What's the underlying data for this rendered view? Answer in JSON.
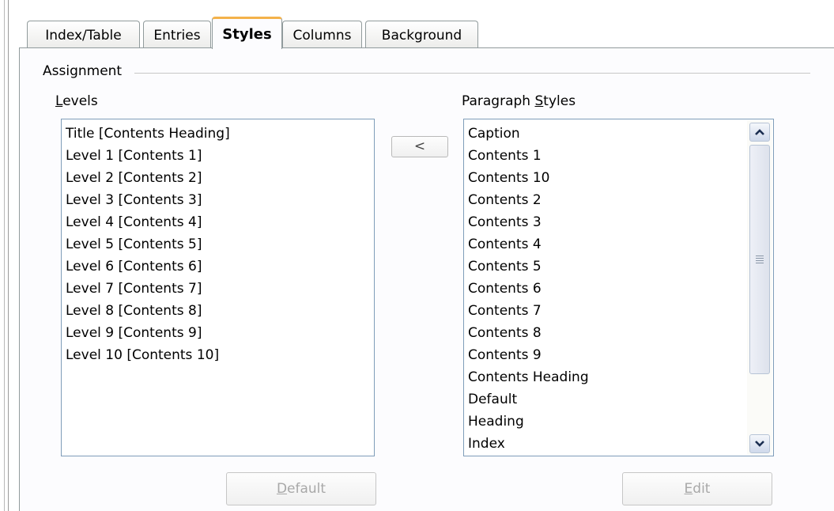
{
  "tabs": [
    "Index/Table",
    "Entries",
    "Styles",
    "Columns",
    "Background"
  ],
  "active_tab": "Styles",
  "assignment": {
    "group_label": "Assignment",
    "levels_label_underlined": "L",
    "levels_label_rest": "evels",
    "levels": [
      "Title [Contents Heading]",
      "Level 1 [Contents 1]",
      "Level 2 [Contents 2]",
      "Level 3 [Contents 3]",
      "Level 4 [Contents 4]",
      "Level 5 [Contents 5]",
      "Level 6 [Contents 6]",
      "Level 7 [Contents 7]",
      "Level 8 [Contents 8]",
      "Level 9 [Contents 9]",
      "Level 10 [Contents 10]"
    ],
    "styles_label_before": "Paragraph ",
    "styles_label_underlined": "S",
    "styles_label_after": "tyles",
    "paragraph_styles": [
      "Caption",
      "Contents 1",
      "Contents 10",
      "Contents 2",
      "Contents 3",
      "Contents 4",
      "Contents 5",
      "Contents 6",
      "Contents 7",
      "Contents 8",
      "Contents 9",
      "Contents Heading",
      "Default",
      "Heading",
      "Index"
    ],
    "assign_button_label": "<",
    "default_button": {
      "underlined": "D",
      "rest": "efault"
    },
    "edit_button": {
      "underlined": "E",
      "rest": "dit"
    }
  },
  "icons": {
    "scroll_up": "chevron-up-icon",
    "scroll_down": "chevron-down-icon",
    "scroll_grip": "grip-icon"
  },
  "colors": {
    "active_tab_accent": "#f4b24a",
    "list_border": "#7f9db9",
    "disabled_text": "#a8a8a8"
  }
}
